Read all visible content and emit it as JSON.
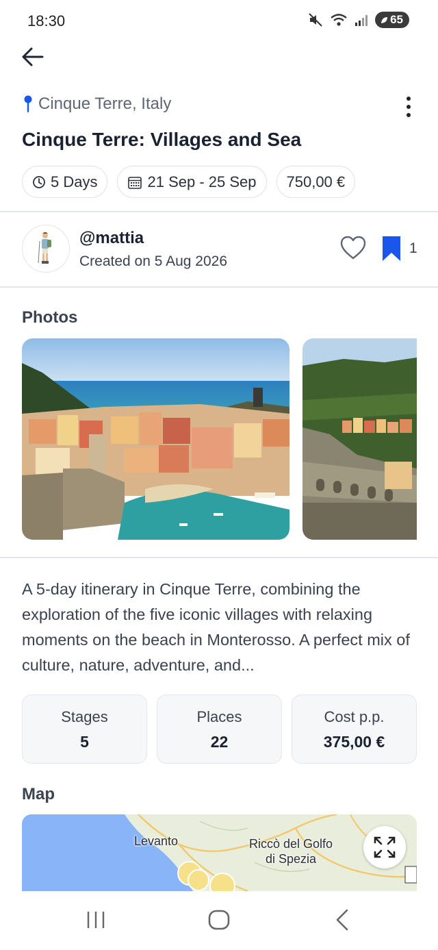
{
  "status_bar": {
    "time": "18:30",
    "battery": "65",
    "icons": [
      "mute-icon",
      "wifi-icon",
      "signal-icon",
      "battery-icon"
    ]
  },
  "header": {
    "location": "Cinque Terre, Italy",
    "title": "Cinque Terre: Villages and Sea",
    "chips": {
      "duration": "5 Days",
      "dates": "21 Sep - 25 Sep",
      "price": "750,00 €"
    }
  },
  "author": {
    "handle": "@mattia",
    "created": "Created on 5 Aug 2026",
    "save_count": "1"
  },
  "photos": {
    "title": "Photos"
  },
  "description": "A 5-day itinerary in Cinque Terre, combining the exploration of the five iconic villages with relaxing moments on the beach in Monterosso. A perfect mix of culture, nature, adventure, and...",
  "stats": [
    {
      "label": "Stages",
      "value": "5"
    },
    {
      "label": "Places",
      "value": "22"
    },
    {
      "label": "Cost p.p.",
      "value": "375,00 €"
    }
  ],
  "map": {
    "title": "Map",
    "labels": {
      "levanto": "Levanto",
      "ricco": "Riccò del Golfo\ndi Spezia"
    }
  },
  "colors": {
    "accent": "#1a56e8",
    "sea": "#8ab4f8",
    "land": "#e8eedb"
  }
}
